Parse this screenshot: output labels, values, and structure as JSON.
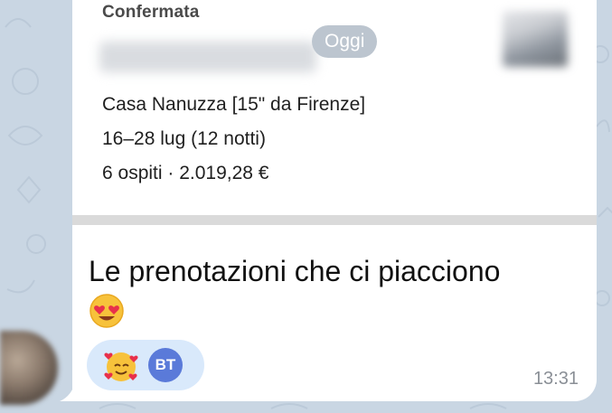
{
  "message": {
    "preview": {
      "status": "Confermata",
      "day_badge": "Oggi",
      "listing": "Casa Nanuzza [15\" da Firenze]",
      "dates": "16–28 lug (12 notti)",
      "guests_price": "6 ospiti · 2.019,28 €"
    },
    "text": "Le prenotazioni che ci piacciono",
    "reaction": {
      "emoji_icon": "smiling-face-with-hearts",
      "user_initials": "BT"
    },
    "time": "13:31"
  },
  "colors": {
    "background": "#c9d6e3",
    "bubble": "#ffffff",
    "reaction_pill": "#d9e9fb",
    "reaction_avatar": "#5a7ad9",
    "badge": "#bcc5cf",
    "time_text": "#8a8f96"
  }
}
